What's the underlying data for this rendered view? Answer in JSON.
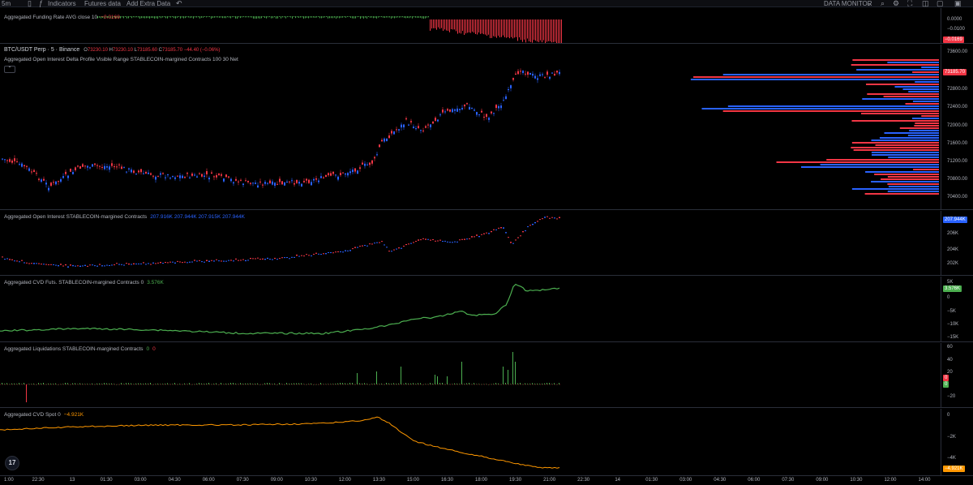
{
  "toolbar": {
    "interval": "5m",
    "indicators": "Indicators",
    "futures": "Futures data",
    "add_extra": "Add Extra Data",
    "data_monitor": "DATA MONITOR"
  },
  "panes": {
    "funding": {
      "label": "Aggregated Funding Rate AVG close 10",
      "value": "−0.0169",
      "ticks": [
        "0.0000",
        "−0.0100"
      ],
      "badge": "−0.0169"
    },
    "price": {
      "symbol": "BTC/USDT Perp · 5 · Binance",
      "open_label": "O",
      "open": "73230.10",
      "high_label": "H",
      "high": "73230.10",
      "low_label": "L",
      "low": "73185.60",
      "close_label": "C",
      "close": "73185.70",
      "change": "−44.40 (−0.06%)",
      "profile_label": "Aggregated Open Interest Delta Profile Visible Range STABLECOIN-margined Contracts 100 30 Net",
      "collapse": "⌃",
      "ticks": [
        "73600.00",
        "72800.00",
        "72400.00",
        "72000.00",
        "71600.00",
        "71200.00",
        "70800.00",
        "70400.00"
      ],
      "badge": "73185.70"
    },
    "oi": {
      "label": "Aggregated Open Interest STABLECOIN-margined Contracts",
      "values": "207.916K 207.944K 207.915K 207.944K",
      "ticks": [
        "206K",
        "204K",
        "202K"
      ],
      "badge": "207.944K"
    },
    "cvd_futs": {
      "label": "Aggregated CVD Futs. STABLECOIN-margined Contracts 0",
      "value": "3.576K",
      "ticks": [
        "5K",
        "0",
        "−5K",
        "−10K",
        "−15K"
      ],
      "badge": "3.576K"
    },
    "liq": {
      "label": "Aggregated Liquidations STABLECOIN-margined Contracts",
      "v1": "0",
      "v2": "0",
      "ticks": [
        "60",
        "40",
        "20",
        "−20"
      ],
      "badge_red": "0",
      "badge_green": "0"
    },
    "cvd_spot": {
      "label": "Aggregated CVD Spot 0",
      "value": "−4.921K",
      "ticks": [
        "0",
        "−2K",
        "−4K"
      ],
      "badge": "−4.921K"
    }
  },
  "time_axis": [
    "1:00",
    "22:30",
    "13",
    "01:30",
    "03:00",
    "04:30",
    "06:00",
    "07:30",
    "09:00",
    "10:30",
    "12:00",
    "13:30",
    "15:00",
    "16:30",
    "18:00",
    "19:30",
    "21:00",
    "22:30",
    "14",
    "01:30",
    "03:00",
    "04:30",
    "06:00",
    "07:30",
    "09:00",
    "10:30",
    "12:00",
    "14:00"
  ],
  "logo": "17",
  "colors": {
    "up": "#2962ff",
    "down": "#f23645",
    "green": "#4caf50",
    "orange": "#ff9800",
    "bg": "#000000"
  },
  "icons": [
    "chevron-down-icon",
    "undo-icon",
    "search-icon",
    "settings-icon",
    "camera-icon",
    "fullscreen-icon",
    "maximize-icon"
  ]
}
